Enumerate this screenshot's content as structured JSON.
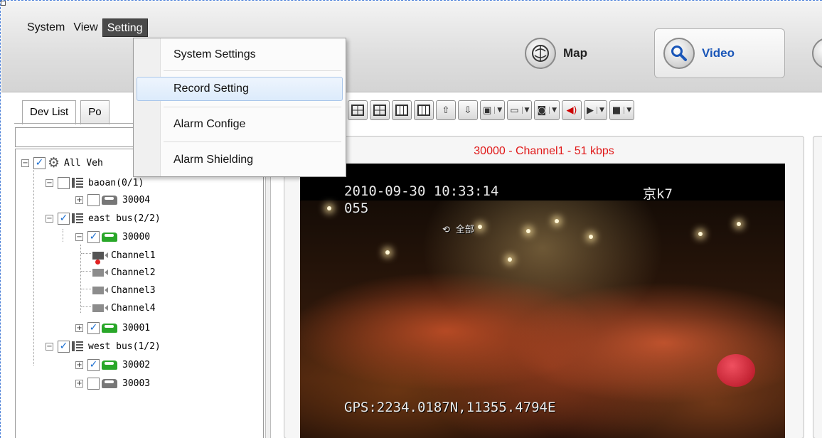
{
  "menubar": {
    "items": [
      "System",
      "View",
      "Setting"
    ],
    "active_index": 2
  },
  "nav": {
    "map_label": "Map",
    "video_label": "Video"
  },
  "left_panel": {
    "tabs": [
      "Dev List",
      "Po"
    ],
    "search": {
      "value": "",
      "placeholder": ""
    }
  },
  "tree": {
    "root": "All Veh",
    "groups": [
      {
        "label": "baoan(0/1)",
        "checked": false,
        "vehicles": [
          {
            "label": "30004",
            "checked": false,
            "online": false
          }
        ]
      },
      {
        "label": "east bus(2/2)",
        "checked": true,
        "vehicles": [
          {
            "label": "30000",
            "checked": true,
            "online": true,
            "channels": [
              "Channel1",
              "Channel2",
              "Channel3",
              "Channel4"
            ]
          },
          {
            "label": "30001",
            "checked": true,
            "online": true
          }
        ]
      },
      {
        "label": "west bus(1/2)",
        "checked": true,
        "vehicles": [
          {
            "label": "30002",
            "checked": true,
            "online": true
          },
          {
            "label": "30003",
            "checked": false,
            "online": false
          }
        ]
      }
    ]
  },
  "setting_menu": {
    "items": [
      "System Settings",
      "Record Setting",
      "Alarm Confige",
      "Alarm Shielding"
    ],
    "hover_index": 1
  },
  "video": {
    "title": "30000 - Channel1 - 51 kbps",
    "osd_datetime": "2010-09-30 10:33:14",
    "osd_plate": "京k7",
    "osd_line2": "055",
    "osd_mark": "全部",
    "osd_gps": "GPS:2234.0187N,11355.4794E"
  },
  "colors": {
    "title_red": "#e01818",
    "accent_blue": "#1a56b8",
    "online_green": "#29a729"
  },
  "icons": [
    "gear-icon",
    "list-icon",
    "car-icon",
    "camera-icon",
    "map-icon",
    "search-icon"
  ]
}
